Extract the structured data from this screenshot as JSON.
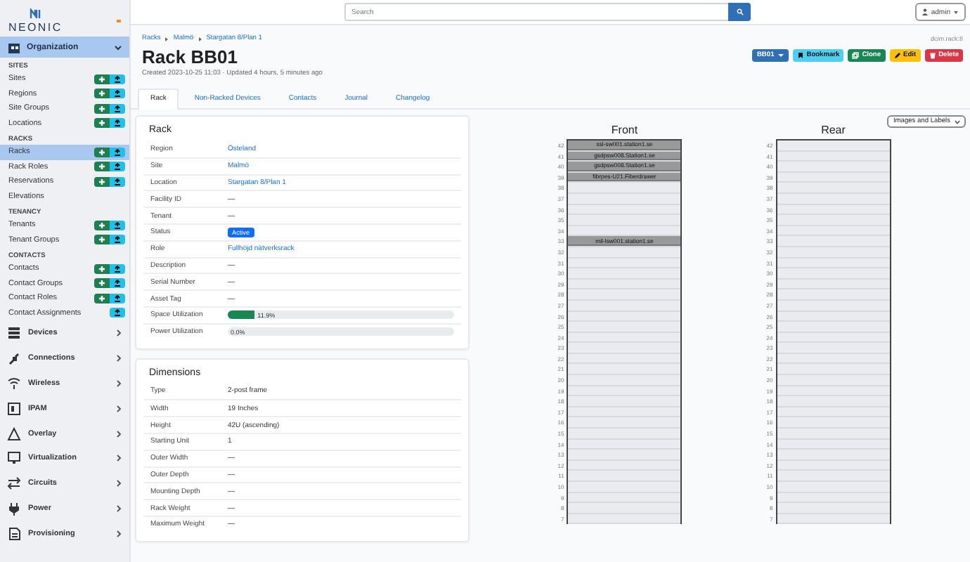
{
  "sidebar": {
    "logo": "NEONIC",
    "menus": [
      {
        "label": "Organization",
        "expanded": true,
        "groups": [
          {
            "heading": "SITES",
            "items": [
              {
                "label": "Sites",
                "selected": false,
                "add": true,
                "import": true
              },
              {
                "label": "Regions",
                "selected": false,
                "add": true,
                "import": true
              },
              {
                "label": "Site Groups",
                "selected": false,
                "add": true,
                "import": true
              },
              {
                "label": "Locations",
                "selected": false,
                "add": true,
                "import": true
              }
            ]
          },
          {
            "heading": "RACKS",
            "items": [
              {
                "label": "Racks",
                "selected": true,
                "add": true,
                "import": true
              },
              {
                "label": "Rack Roles",
                "selected": false,
                "add": true,
                "import": true
              },
              {
                "label": "Reservations",
                "selected": false,
                "add": true,
                "import": true
              },
              {
                "label": "Elevations",
                "selected": false,
                "add": false,
                "import": false
              }
            ]
          },
          {
            "heading": "TENANCY",
            "items": [
              {
                "label": "Tenants",
                "selected": false,
                "add": true,
                "import": true
              },
              {
                "label": "Tenant Groups",
                "selected": false,
                "add": true,
                "import": true
              }
            ]
          },
          {
            "heading": "CONTACTS",
            "items": [
              {
                "label": "Contacts",
                "selected": false,
                "add": true,
                "import": true
              },
              {
                "label": "Contact Groups",
                "selected": false,
                "add": true,
                "import": true
              },
              {
                "label": "Contact Roles",
                "selected": false,
                "add": true,
                "import": true
              },
              {
                "label": "Contact Assignments",
                "selected": false,
                "add": false,
                "import": true
              }
            ]
          }
        ]
      },
      {
        "label": "Devices",
        "expanded": false
      },
      {
        "label": "Connections",
        "expanded": false
      },
      {
        "label": "Wireless",
        "expanded": false
      },
      {
        "label": "IPAM",
        "expanded": false
      },
      {
        "label": "Overlay",
        "expanded": false
      },
      {
        "label": "Virtualization",
        "expanded": false
      },
      {
        "label": "Circuits",
        "expanded": false
      },
      {
        "label": "Power",
        "expanded": false
      },
      {
        "label": "Provisioning",
        "expanded": false
      }
    ]
  },
  "topbar": {
    "search": {
      "placeholder": "Search"
    },
    "user": "admin"
  },
  "header": {
    "breadcrumbs": [
      "Racks",
      "Malmö",
      "Stargatan 8/Plan 1"
    ],
    "title": "Rack BB01",
    "meta": "Created 2023-10-25 11:03 · Updated 4 hours, 5 minutes ago",
    "object_id": "dcim.rack:8",
    "buttons": [
      {
        "label": "BB01",
        "kind": "dropdown"
      },
      {
        "label": "Bookmark",
        "kind": "bookmark"
      },
      {
        "label": "Clone",
        "kind": "clone"
      },
      {
        "label": "Edit",
        "kind": "edit"
      },
      {
        "label": "Delete",
        "kind": "delete"
      }
    ],
    "tabs": [
      {
        "label": "Rack",
        "selected": true
      },
      {
        "label": "Non-Racked Devices",
        "selected": false
      },
      {
        "label": "Contacts",
        "selected": false
      },
      {
        "label": "Journal",
        "selected": false
      },
      {
        "label": "Changelog",
        "selected": false
      }
    ]
  },
  "cards": [
    {
      "title": "Rack",
      "rows": [
        {
          "label": "Region",
          "kind": "link",
          "value": "Östeland"
        },
        {
          "label": "Site",
          "kind": "link",
          "value": "Malmö"
        },
        {
          "label": "Location",
          "kind": "link",
          "value": "Stargatan 8/Plan 1"
        },
        {
          "label": "Facility ID",
          "kind": "text",
          "value": "—"
        },
        {
          "label": "Tenant",
          "kind": "text",
          "value": "—"
        },
        {
          "label": "Status",
          "kind": "badge",
          "value": "Active"
        },
        {
          "label": "Role",
          "kind": "link",
          "value": "Fullhöjd nätverksrack"
        },
        {
          "label": "Description",
          "kind": "text",
          "value": "—"
        },
        {
          "label": "Serial Number",
          "kind": "text",
          "value": "—"
        },
        {
          "label": "Asset Tag",
          "kind": "text",
          "value": "—"
        },
        {
          "label": "Space Utilization",
          "kind": "progress",
          "value": "11.9%",
          "level": 0.119
        },
        {
          "label": "Power Utilization",
          "kind": "progress",
          "value": "0.0%",
          "level": 0
        }
      ]
    },
    {
      "title": "Dimensions",
      "rows": [
        {
          "label": "Type",
          "kind": "text",
          "value": "2-post frame"
        },
        {
          "label": "Width",
          "kind": "text",
          "value": "19 Inches"
        },
        {
          "label": "Height",
          "kind": "text",
          "value": "42U (ascending)"
        },
        {
          "label": "Starting Unit",
          "kind": "text",
          "value": "1"
        },
        {
          "label": "Outer Width",
          "kind": "text",
          "value": "—"
        },
        {
          "label": "Outer Depth",
          "kind": "text",
          "value": "—"
        },
        {
          "label": "Mounting Depth",
          "kind": "text",
          "value": "—"
        },
        {
          "label": "Rack Weight",
          "kind": "text",
          "value": "—"
        },
        {
          "label": "Maximum Weight",
          "kind": "text",
          "value": "—"
        }
      ]
    }
  ],
  "rack_view": {
    "select": "Images and Labels",
    "faces": [
      {
        "title": "Front",
        "units": [
          {
            "number": "42",
            "device": "ssl-sw001.station1.se"
          },
          {
            "number": "41",
            "device": "gsdpsw008.Station1.se"
          },
          {
            "number": "40",
            "device": "gsdpsw008.Station1.se"
          },
          {
            "number": "39",
            "device": "fibrpes-U21.Fiberdrawer"
          },
          {
            "number": "38"
          },
          {
            "number": "37"
          },
          {
            "number": "36"
          },
          {
            "number": "35"
          },
          {
            "number": "34"
          },
          {
            "number": "33",
            "device": "mil-lsw001.station1.se"
          },
          {
            "number": "32"
          },
          {
            "number": "31"
          },
          {
            "number": "30"
          },
          {
            "number": "29"
          },
          {
            "number": "28"
          },
          {
            "number": "27"
          },
          {
            "number": "26"
          },
          {
            "number": "25"
          },
          {
            "number": "24"
          },
          {
            "number": "23"
          },
          {
            "number": "22"
          },
          {
            "number": "21"
          },
          {
            "number": "20"
          },
          {
            "number": "19"
          },
          {
            "number": "18"
          },
          {
            "number": "17"
          },
          {
            "number": "16"
          },
          {
            "number": "15"
          },
          {
            "number": "14"
          },
          {
            "number": "13"
          },
          {
            "number": "12"
          },
          {
            "number": "11"
          },
          {
            "number": "10"
          },
          {
            "number": "9"
          },
          {
            "number": "8"
          },
          {
            "number": "7"
          }
        ]
      },
      {
        "title": "Rear",
        "units": [
          {
            "number": "42"
          },
          {
            "number": "41"
          },
          {
            "number": "40"
          },
          {
            "number": "39"
          },
          {
            "number": "38"
          },
          {
            "number": "37"
          },
          {
            "number": "36"
          },
          {
            "number": "35"
          },
          {
            "number": "34"
          },
          {
            "number": "33"
          },
          {
            "number": "32"
          },
          {
            "number": "31"
          },
          {
            "number": "30"
          },
          {
            "number": "29"
          },
          {
            "number": "28"
          },
          {
            "number": "27"
          },
          {
            "number": "26"
          },
          {
            "number": "25"
          },
          {
            "number": "24"
          },
          {
            "number": "23"
          },
          {
            "number": "22"
          },
          {
            "number": "21"
          },
          {
            "number": "20"
          },
          {
            "number": "19"
          },
          {
            "number": "18"
          },
          {
            "number": "17"
          },
          {
            "number": "16"
          },
          {
            "number": "15"
          },
          {
            "number": "14"
          },
          {
            "number": "13"
          },
          {
            "number": "12"
          },
          {
            "number": "11"
          },
          {
            "number": "10"
          },
          {
            "number": "9"
          },
          {
            "number": "8"
          },
          {
            "number": "7"
          }
        ]
      }
    ]
  }
}
